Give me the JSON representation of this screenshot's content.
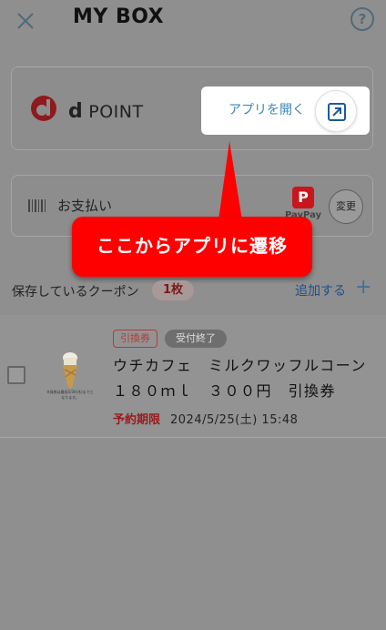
{
  "header": {
    "title": "MY BOX",
    "help_label": "?"
  },
  "dpoint": {
    "logo_letter": "d",
    "brand": "POINT",
    "open_app_label": "アプリを開く"
  },
  "payment": {
    "label": "お支払い",
    "method": "PayPay",
    "change_label": "変更"
  },
  "callout": {
    "text": "ここからアプリに遷移"
  },
  "coupons": {
    "title": "保存しているクーポン",
    "count": "1枚",
    "add_label": "追加する",
    "add_icon": "+",
    "items": [
      {
        "badge_type": "引換券",
        "badge_status": "受付終了",
        "name": "ウチカフェ　ミルクワッフルコーン　１８０ｍｌ　３００円　引換券",
        "deadline_label": "予約期限",
        "deadline_value": "2024/5/25(土) 15:48",
        "image_note": "※発券は最長5/30(木)までとなります。"
      }
    ]
  },
  "colors": {
    "overlay": "#8f8f8f",
    "callout": "#ff0000",
    "link": "#1f4e8c",
    "dpoint_red": "#c8161d"
  }
}
